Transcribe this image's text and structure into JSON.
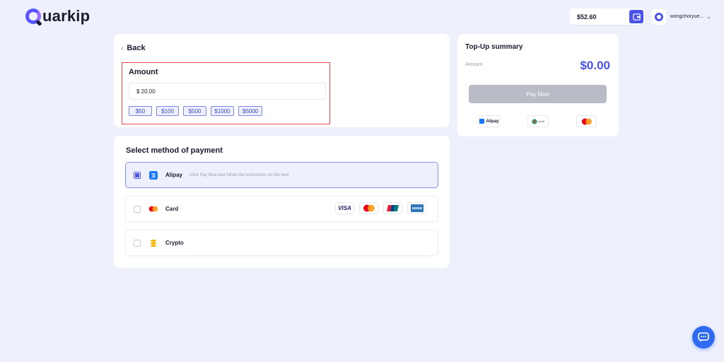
{
  "brand": {
    "name": "uarkip",
    "accent": "#4a52e8"
  },
  "header": {
    "balance": "$52.60",
    "username": "wongchoryue...",
    "icons": {
      "wallet": "wallet-icon",
      "user_menu": "chevron-down-icon"
    }
  },
  "amount_section": {
    "back_label": "Back",
    "title": "Amount",
    "input_value": "$ 20.00",
    "presets": [
      "$50",
      "$100",
      "$500",
      "$1000",
      "$5000"
    ]
  },
  "payment_methods": {
    "title": "Select method of payment",
    "options": [
      {
        "id": "alipay",
        "label": "Alipay",
        "hint": "Click Pay Now and follow the instructions on the next",
        "selected": true,
        "icon": "alipay-icon"
      },
      {
        "id": "card",
        "label": "Card",
        "hint": "",
        "selected": false,
        "icon": "mastercard-icon",
        "logos": [
          "VISA",
          "mastercard",
          "unionpay",
          "amex"
        ]
      },
      {
        "id": "crypto",
        "label": "Crypto",
        "hint": "",
        "selected": false,
        "icon": "coins-icon"
      }
    ]
  },
  "summary": {
    "title": "Top-Up summary",
    "amount_label": "Amount",
    "amount_value": "$0.00",
    "pay_button": "Pay Now",
    "logos": [
      "Alipay",
      "credit",
      "mastercard"
    ]
  },
  "chat": {
    "icon": "chat-bubble-icon"
  }
}
